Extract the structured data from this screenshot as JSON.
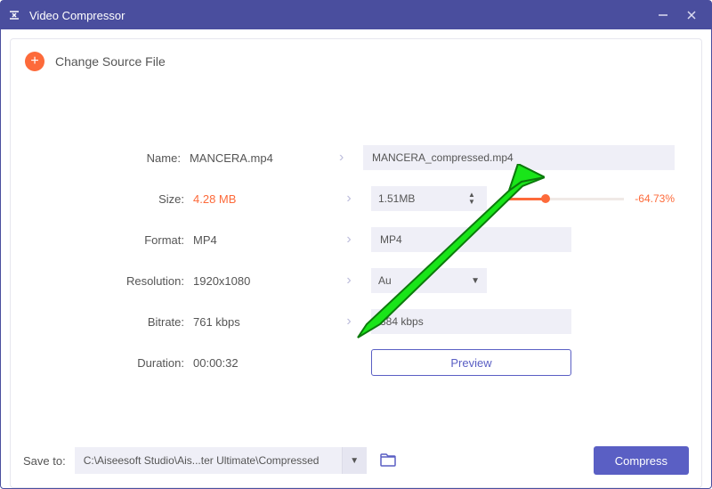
{
  "titlebar": {
    "title": "Video Compressor"
  },
  "header": {
    "change_source": "Change Source File"
  },
  "labels": {
    "name": "Name:",
    "size": "Size:",
    "format": "Format:",
    "resolution": "Resolution:",
    "bitrate": "Bitrate:",
    "duration": "Duration:"
  },
  "source": {
    "name": "MANCERA.mp4",
    "size": "4.28 MB",
    "format": "MP4",
    "resolution": "1920x1080",
    "bitrate": "761 kbps",
    "duration": "00:00:32"
  },
  "target": {
    "name": "MANCERA_compressed.mp4",
    "size": "1.51MB",
    "format": "MP4",
    "resolution": "Au",
    "bitrate": "384 kbps"
  },
  "slider": {
    "fill_pct": 35,
    "reduction": "-64.73%"
  },
  "buttons": {
    "preview": "Preview",
    "compress": "Compress"
  },
  "save": {
    "label": "Save to:",
    "path": "C:\\Aiseesoft Studio\\Ais...ter Ultimate\\Compressed"
  }
}
